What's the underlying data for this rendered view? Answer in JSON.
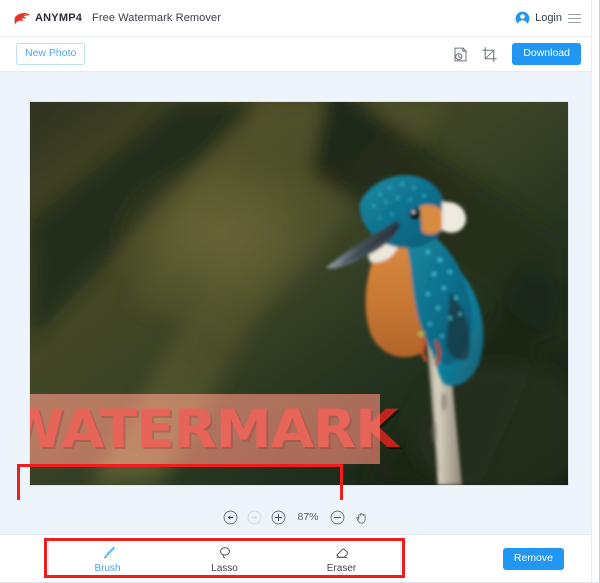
{
  "header": {
    "brand_name": "ANYMP4",
    "app_name": "Free Watermark Remover",
    "logo_icon": "anymp4-bird-logo-icon",
    "login_label": "Login",
    "avatar_icon": "user-avatar-icon",
    "menu_icon": "hamburger-menu-icon",
    "accent_color": "#e8352b"
  },
  "toolbar": {
    "new_photo_label": "New Photo",
    "history_icon": "history-clock-icon",
    "crop_icon": "crop-icon",
    "download_label": "Download",
    "primary_color": "#2196f3",
    "outline_color": "#bcdffb"
  },
  "canvas": {
    "background_color": "#eef4fb",
    "photo_alt": "kingfisher-bird-perched-on-branch",
    "watermark_text": "WATERMARK",
    "watermark_color": "#c0241c",
    "selection_overlay_color": "#ff786e",
    "annotation_color": "#ef1d1d"
  },
  "zoombar": {
    "undo_icon": "undo-arrow-icon",
    "redo_icon": "redo-arrow-icon",
    "zoom_in_icon": "zoom-in-plus-icon",
    "zoom_level": "87%",
    "zoom_out_icon": "zoom-out-minus-icon",
    "pan_icon": "hand-pan-icon"
  },
  "bottombar": {
    "tools": [
      {
        "id": "brush",
        "label": "Brush",
        "icon": "paintbrush-icon",
        "active": true
      },
      {
        "id": "lasso",
        "label": "Lasso",
        "icon": "lasso-icon",
        "active": false
      },
      {
        "id": "eraser",
        "label": "Eraser",
        "icon": "eraser-icon",
        "active": false
      }
    ],
    "remove_label": "Remove"
  }
}
